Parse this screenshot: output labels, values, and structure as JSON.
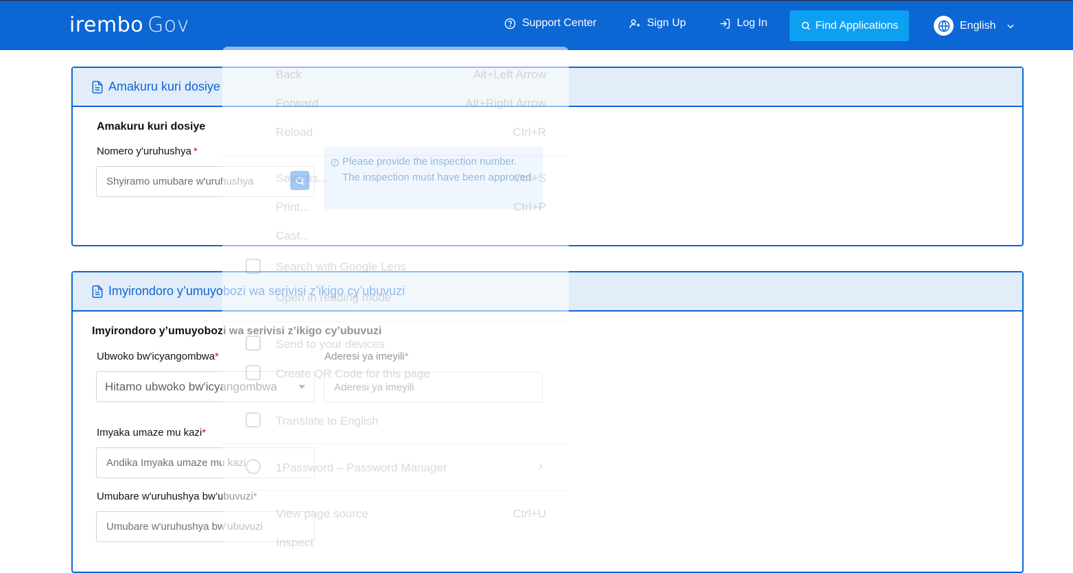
{
  "header": {
    "logo_brand": "irembo",
    "logo_suffix": "Gov",
    "nav": {
      "support": "Support Center",
      "signup": "Sign Up",
      "login": "Log In"
    },
    "find_applications": "Find Applications",
    "language": "English",
    "colors": {
      "bar": "#0c66d4",
      "find_button": "#0d9ff2"
    }
  },
  "section1": {
    "header_title": "Amakuru kuri dosiye",
    "subtitle": "Amakuru kuri dosiye",
    "permit_label": "Nomero y'uruhushya",
    "permit_required": "*",
    "permit_placeholder": "Shyiramo umubare w'uruhushya",
    "info_text": "Please provide the inspection number. The inspection must have been approved."
  },
  "section2": {
    "header_title": "Imyirondoro y’umuyobozi wa serivisi z’ikigo cy’ubuvuzi",
    "subtitle": "Imyirondoro y’umuyobozi wa serivisi z’ikigo cy’ubuvuzi",
    "profession_label": "Ubwoko bw'icyangombwa",
    "profession_required": "*",
    "profession_value": "Hitamo ubwoko bw'icyangombwa",
    "email_label": "Aderesi ya imeyili",
    "email_required": "*",
    "email_placeholder": "Aderesi ya imeyili",
    "years_label": "Imyaka umaze mu kazi",
    "years_required": "*",
    "years_placeholder": "Andika Imyaka umaze mu kazi",
    "license_label": "Umubare w'uruhushya bw’ubuvuzi",
    "license_required": "*",
    "license_placeholder": "Umubare w'uruhushya bw’ubuvuzi"
  },
  "context_menu": {
    "back": "Back",
    "back_shortcut": "Alt+Left Arrow",
    "forward": "Forward",
    "forward_shortcut": "Alt+Right Arrow",
    "reload": "Reload",
    "reload_shortcut": "Ctrl+R",
    "save": "Save as...",
    "save_shortcut": "Ctrl+S",
    "print": "Print...",
    "print_shortcut": "Ctrl+P",
    "cast": "Cast...",
    "lens": "Search with Google Lens",
    "reading": "Open in reading mode",
    "send": "Send to your devices",
    "qr": "Create QR Code for this page",
    "translate": "Translate to English",
    "password": "1Password – Password Manager",
    "source": "View page source",
    "source_shortcut": "Ctrl+U",
    "inspect": "Inspect"
  }
}
